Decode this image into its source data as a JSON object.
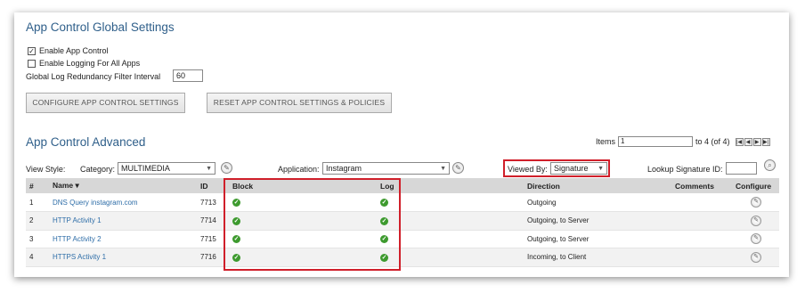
{
  "global": {
    "title": "App Control Global Settings",
    "enable_app_control": {
      "label": "Enable App Control",
      "checked": true
    },
    "enable_logging": {
      "label": "Enable Logging For All Apps",
      "checked": false
    },
    "interval_label": "Global Log Redundancy Filter Interval",
    "interval_value": "60",
    "configure_button": "CONFIGURE APP CONTROL SETTINGS",
    "reset_button": "RESET APP CONTROL SETTINGS & POLICIES"
  },
  "advanced": {
    "title": "App Control Advanced",
    "items_label": "Items",
    "items_value": "1",
    "items_range": "to 4 (of 4)",
    "pager": [
      "first",
      "prev",
      "next",
      "last"
    ],
    "view_style_label": "View Style:",
    "category_label": "Category:",
    "category_value": "MULTIMEDIA",
    "application_label": "Application:",
    "application_value": "Instagram",
    "viewed_by_label": "Viewed By:",
    "viewed_by_value": "Signature",
    "lookup_label": "Lookup Signature ID:",
    "highlight_color": "#d01f2a"
  },
  "table": {
    "headers": {
      "num": "#",
      "name": "Name",
      "id": "ID",
      "block": "Block",
      "log": "Log",
      "direction": "Direction",
      "comments": "Comments",
      "configure": "Configure"
    },
    "rows": [
      {
        "num": "1",
        "name": "DNS Query instagram.com",
        "id": "7713",
        "direction": "Outgoing"
      },
      {
        "num": "2",
        "name": "HTTP Activity 1",
        "id": "7714",
        "direction": "Outgoing, to Server"
      },
      {
        "num": "3",
        "name": "HTTP Activity 2",
        "id": "7715",
        "direction": "Outgoing, to Server"
      },
      {
        "num": "4",
        "name": "HTTPS Activity 1",
        "id": "7716",
        "direction": "Incoming, to Client"
      }
    ]
  }
}
